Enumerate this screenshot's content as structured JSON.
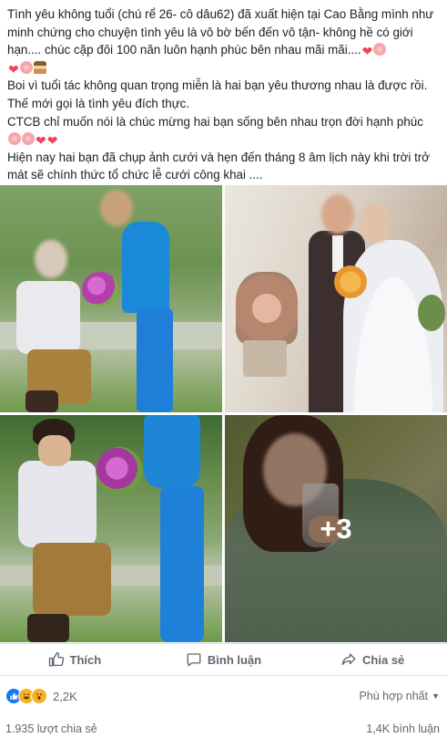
{
  "post": {
    "paragraphs": [
      "Tình yêu không tuổi (chú rể 26- cô dâu62) đã xuất hiện tại Cao Bằng mình như minh chứng cho chuyện tình yêu là vô bờ bến đến vô tận- không hề có giới hạn.... chúc cặp đôi 100 năn luôn hạnh phúc bên nhau mãi mãi....",
      "Boi vì tuổi tác không quan trọng miễn là hai bạn yêu thương nhau là được rồi. Thế mới gọi là tình yêu đích thực.",
      "CTCB chỉ muốn nói là chúc mừng hai bạn sống bên nhau trọn đời hạnh phúc",
      "Hiện nay hai bạn đã chụp ảnh cưới và hẹn đến tháng 8 âm lịch này khi trời trở mát sẽ chính thức tổ chức lễ cưới công khai ...."
    ]
  },
  "photos": {
    "more_count": "+3"
  },
  "actions": {
    "like": "Thích",
    "comment": "Bình luận",
    "share": "Chia sẻ"
  },
  "reactions": {
    "count": "2,2K",
    "sort_label": "Phù hợp nhất",
    "icons": [
      "like-icon",
      "haha-icon",
      "wow-icon"
    ]
  },
  "stats": {
    "shares": "1.935 lượt chia sẻ",
    "comments": "1,4K bình luận"
  },
  "colors": {
    "accent": "#1877f2",
    "heart": "#f0445e",
    "text_secondary": "#606770"
  }
}
